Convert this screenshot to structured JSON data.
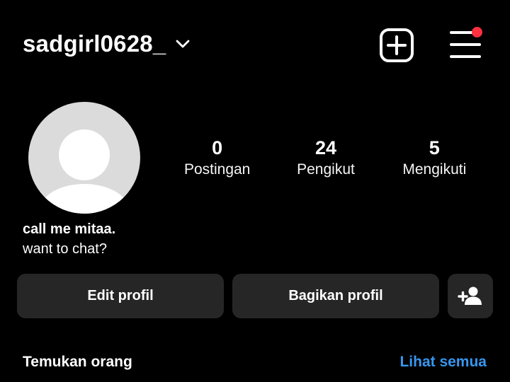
{
  "header": {
    "username": "sadgirl0628_"
  },
  "profile": {
    "stats": [
      {
        "value": "0",
        "label": "Postingan"
      },
      {
        "value": "24",
        "label": "Pengikut"
      },
      {
        "value": "5",
        "label": "Mengikuti"
      }
    ],
    "bio_name": "call me mitaa.",
    "bio_text": "want to chat?"
  },
  "actions": {
    "edit_label": "Edit profil",
    "share_label": "Bagikan profil"
  },
  "discover": {
    "title": "Temukan orang",
    "see_all": "Lihat semua"
  },
  "colors": {
    "background": "#000000",
    "button_bg": "#262626",
    "link": "#3797f0",
    "notification": "#ff3040",
    "avatar_bg": "#dbdbdb"
  },
  "icons": {
    "chevron": "chevron-down-icon",
    "add": "plus-square-icon",
    "menu": "hamburger-menu-icon",
    "add_user": "add-user-icon"
  }
}
